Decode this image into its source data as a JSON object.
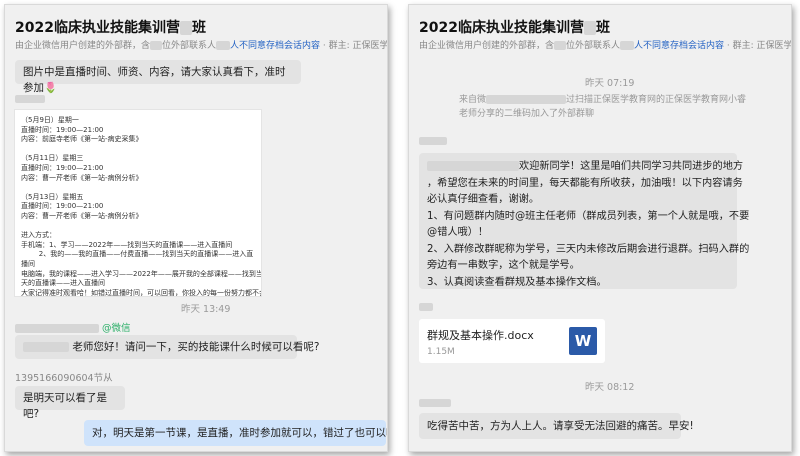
{
  "left": {
    "header": {
      "title": "2022临床执业技能集训营",
      "title_suffix": "班",
      "subtitle_prefix": "由企业微信用户创建的外部群，含",
      "subtitle_mid": "位外部联系人",
      "subtitle_link": "人不同意存档会话内容",
      "subtitle_suffix": " · 群主: 正保医学教育网"
    },
    "messages": {
      "intro": "图片中是直播时间、师资、内容，请大家认真看下，准时参加",
      "intro_emoji": "🌷",
      "schedule_image_text": "（5月9日）星期一\n直播时间：19:00—21:00\n内容：前庭寺老师《第一站-病史采集》\n\n（5月11日）星期三\n直播时间：19:00—21:00\n内容：曹一芹老师《第一站-病例分析》\n\n（5月13日）星期五\n直播时间：19:00—21:00\n内容：曹一芹老师《第一站-病例分析》\n\n进入方式：\n手机端：1、学习——2022年——找到当天的直播课——进入直播间\n        2、我的——我的直播——付费直播——找到当天的直播课——进入直\n播间\n电脑端，我的课程——进入学习——2022年——展开我的全部课程——找到当\n天的直播课——进入直播间\n大家记得准时观看哈！如错过直播时间，可以回看，你投入的每一份努力都不会\n白费！加油！！！",
      "time1": "昨天 13:49",
      "wechat_tag": "@微信",
      "q1_suffix": "老师您好！请问一下，买的技能课什么时候可以看呢?",
      "q2_sender": "1395166090604节从",
      "q2_text": "是明天可以看了是吧?",
      "reply": "对，明天是第一节课，是直播，准时参加就可以，错过了也可以听回放"
    }
  },
  "right": {
    "header": {
      "title": "2022临床执业技能集训营",
      "title_suffix": "班",
      "subtitle_prefix": "由企业微信用户创建的外部群，含",
      "subtitle_mid": "位外部联系人",
      "subtitle_link": "人不同意存档会话内容",
      "subtitle_suffix": " · 群主: 正保医学教育网"
    },
    "messages": {
      "time1": "昨天 07:19",
      "join_notice_1": "来自微",
      "join_notice_2": "过扫描正保医学教育网的正保医学教育网小睿",
      "join_notice_3": "老师分享的二维码加入了外部群聊",
      "welcome_1": "欢迎新同学！这里是咱们共同学习共同进步的地方",
      "welcome_2": "，希望您在未来的时间里，每天都能有所收获，加油哦！以下内容请务",
      "welcome_3": "必认真仔细查看，谢谢。",
      "welcome_4": "1、有问题群内随时@班主任老师（群成员列表，第一个人就是哦，不要",
      "welcome_5": "@错人哦）！",
      "welcome_6": "2、入群修改群昵称为学号，三天内未修改后期会进行退群。扫码入群的",
      "welcome_7": "旁边有一串数字，这个就是学号。",
      "welcome_8": "3、认真阅读查看群规及基本操作文档。",
      "file_name": "群规及基本操作.docx",
      "file_size": "1.15M",
      "file_icon": "W",
      "time2": "昨天 08:12",
      "motto": "吃得苦中苦，方为人上人。请享受无法回避的痛苦。早安!"
    }
  }
}
